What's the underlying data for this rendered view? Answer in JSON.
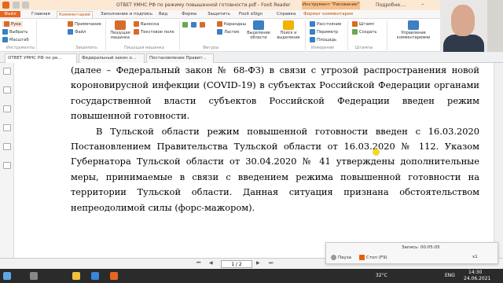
{
  "titlebar": {
    "title": "ОТВЕТ УМНС РФ по режиму повышенной готовности.pdf - Foxit Reader",
    "tool": "Инструмент \"Рисование\"",
    "user": "Подробне...."
  },
  "menu": [
    "Файл",
    "Главная",
    "Комментарий",
    "Заполнение и подпись",
    "Вид",
    "Форма",
    "Защитить",
    "Foxit eSign",
    "Справка",
    "Формат комментария"
  ],
  "ribbon": {
    "hand": "Рука",
    "select": "Выбрать",
    "zoom": "Масштаб",
    "note": "Примечание",
    "file": "Файл",
    "typewriter": "Пишущая машинка",
    "callout": "Выноска",
    "textbox": "Текстовое поле",
    "pencil": "Карандаш",
    "eraser": "Ластик",
    "highlight": "Выделение области",
    "search_highlight": "Поиск и выделение",
    "distance": "Расстояние",
    "perimeter": "Периметр",
    "area": "Площадь",
    "stamp": "Штамп",
    "create": "Создать",
    "manage": "Управление комментариями",
    "groups": [
      "Инструменты",
      "Закрепить",
      "Пишущая машинка",
      "Фигуры",
      "Измерение",
      "Штампы"
    ]
  },
  "tabs": [
    "ОТВЕТ УМНС РФ по ре...",
    "Федеральный закон о...",
    "Постановление Правит..."
  ],
  "doc": {
    "p1": "(далее – Федеральный закон № 68-ФЗ) в связи с угрозой распространения новой короновирусной инфекции (COVID-19) в субъектах Российской Федерации органами государственной власти субъектов Российской Федерации введен режим повышенной готовности.",
    "p2": "В Тульской области режим повышенной готовности введен с 16.03.2020 Постановлением Правительства Тульской области от 16.03.2020 № 112. Указом Губернатора Тульской области от 30.04.2020 № 41 утверждены дополнительные меры, принимаемые в связи с введением режима повышенной готовности на территории Тульской области. Данная ситуация признана обстоятельством непреодолимой силы (форс-мажором)."
  },
  "status": {
    "page": "1 / 2"
  },
  "recorder": {
    "label": "Запись:",
    "time": "00:05:05",
    "pause": "Пауза",
    "stop": "Стоп (F9)",
    "zoom": "x1"
  },
  "taskbar": {
    "temp": "32°C",
    "lang": "ENG",
    "time": "14:30",
    "date": "24.06.2021"
  }
}
